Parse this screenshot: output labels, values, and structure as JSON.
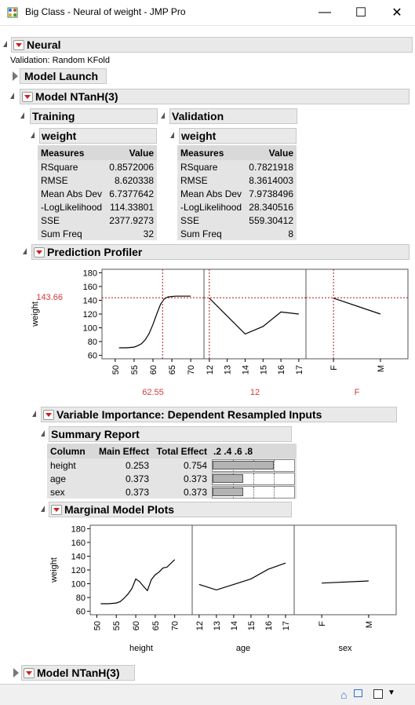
{
  "window": {
    "title": "Big Class - Neural of weight - JMP Pro"
  },
  "neural": {
    "title": "Neural",
    "validation": "Validation: Random KFold"
  },
  "model_launch": {
    "title": "Model Launch"
  },
  "model": {
    "title": "Model NTanH(3)"
  },
  "training": {
    "title": "Training",
    "var": "weight",
    "headers": [
      "Measures",
      "Value"
    ],
    "rows": [
      [
        "RSquare",
        "0.8572006"
      ],
      [
        "RMSE",
        "8.620338"
      ],
      [
        "Mean Abs Dev",
        "6.7377642"
      ],
      [
        "-LogLikelihood",
        "114.33801"
      ],
      [
        "SSE",
        "2377.9273"
      ],
      [
        "Sum Freq",
        "32"
      ]
    ]
  },
  "validation": {
    "title": "Validation",
    "var": "weight",
    "headers": [
      "Measures",
      "Value"
    ],
    "rows": [
      [
        "RSquare",
        "0.7821918"
      ],
      [
        "RMSE",
        "8.3614003"
      ],
      [
        "Mean Abs Dev",
        "7.9738496"
      ],
      [
        "-LogLikelihood",
        "28.340516"
      ],
      [
        "SSE",
        "559.30412"
      ],
      [
        "Sum Freq",
        "8"
      ]
    ]
  },
  "profiler": {
    "title": "Prediction Profiler",
    "ylabel": "weight",
    "yvalue": "143.66",
    "yticks": [
      "180",
      "160",
      "140",
      "120",
      "100",
      "80",
      "60"
    ],
    "panels": [
      {
        "xlabel": "height",
        "current": "62.55",
        "ticks": [
          "50",
          "55",
          "60",
          "65",
          "70"
        ]
      },
      {
        "xlabel": "age",
        "current": "12",
        "ticks": [
          "12",
          "13",
          "14",
          "15",
          "16",
          "17"
        ]
      },
      {
        "xlabel": "sex",
        "current": "F",
        "ticks": [
          "F",
          "M"
        ]
      }
    ]
  },
  "var_importance": {
    "title": "Variable Importance: Dependent Resampled Inputs"
  },
  "summary": {
    "title": "Summary Report",
    "headers": [
      "Column",
      "Main Effect",
      "Total Effect",
      ".2 .4 .6 .8"
    ],
    "rows": [
      {
        "column": "height",
        "main": "0.253",
        "total": "0.754",
        "bar": 0.754
      },
      {
        "column": "age",
        "main": "0.373",
        "total": "0.373",
        "bar": 0.373
      },
      {
        "column": "sex",
        "main": "0.373",
        "total": "0.373",
        "bar": 0.373
      }
    ]
  },
  "marginal": {
    "title": "Marginal Model Plots",
    "ylabel": "weight",
    "yticks": [
      "180",
      "160",
      "140",
      "120",
      "100",
      "80",
      "60"
    ],
    "panels": [
      {
        "xlabel": "height",
        "ticks": [
          "50",
          "55",
          "60",
          "65",
          "70"
        ]
      },
      {
        "xlabel": "age",
        "ticks": [
          "12",
          "13",
          "14",
          "15",
          "16",
          "17"
        ]
      },
      {
        "xlabel": "sex",
        "ticks": [
          "F",
          "M"
        ]
      }
    ]
  },
  "model2": {
    "title": "Model NTanH(3)"
  },
  "chart_data": [
    {
      "type": "line",
      "title": "Prediction Profiler",
      "ylabel": "weight",
      "ylim": [
        55,
        185
      ],
      "series": [
        {
          "name": "height",
          "x": [
            51,
            53,
            55,
            56,
            57,
            58,
            59,
            60,
            61,
            62,
            63,
            64,
            66,
            68,
            70
          ],
          "y": [
            71,
            71,
            72,
            74,
            77,
            83,
            92,
            105,
            120,
            134,
            142,
            145,
            146,
            146,
            146
          ]
        },
        {
          "name": "age",
          "x": [
            12,
            13,
            14,
            15,
            16,
            17
          ],
          "y": [
            143,
            117,
            91,
            102,
            123,
            120
          ]
        },
        {
          "name": "sex",
          "x": [
            "F",
            "M"
          ],
          "y": [
            143,
            120
          ]
        }
      ]
    },
    {
      "type": "line",
      "title": "Marginal Model Plots",
      "ylabel": "weight",
      "ylim": [
        55,
        185
      ],
      "series": [
        {
          "name": "height",
          "x": [
            51,
            53,
            55,
            56,
            57,
            58,
            59,
            60,
            61,
            62,
            63,
            64,
            65,
            66,
            67,
            68,
            70
          ],
          "y": [
            71,
            71,
            72,
            74,
            79,
            85,
            93,
            107,
            103,
            96,
            90,
            106,
            113,
            117,
            123,
            124,
            135
          ]
        },
        {
          "name": "age",
          "x": [
            12,
            13,
            14,
            15,
            16,
            17
          ],
          "y": [
            99,
            91,
            99,
            107,
            121,
            130
          ]
        },
        {
          "name": "sex",
          "x": [
            "F",
            "M"
          ],
          "y": [
            101,
            104
          ]
        }
      ]
    }
  ]
}
